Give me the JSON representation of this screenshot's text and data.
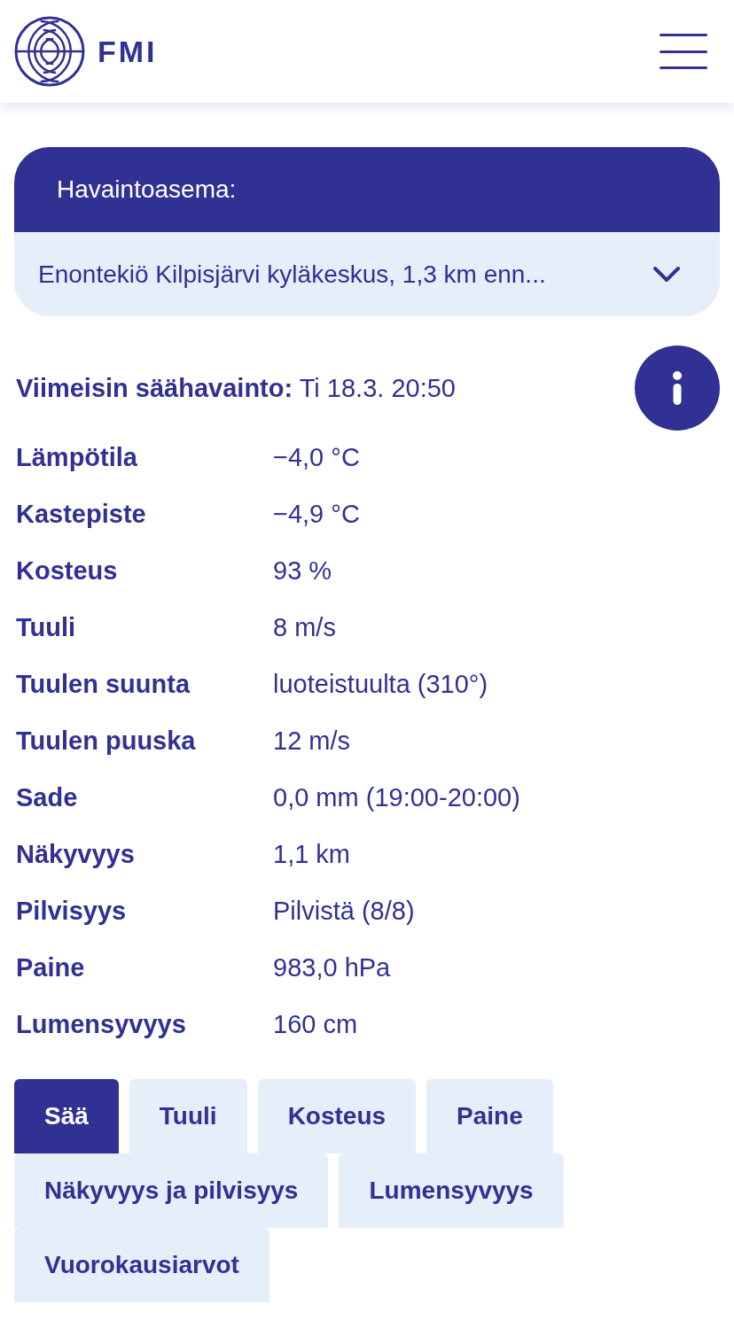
{
  "header": {
    "logo_text": "FMI"
  },
  "station": {
    "label": "Havaintoasema:",
    "value": "Enontekiö Kilpisjärvi kyläkeskus, 1,3 km enn..."
  },
  "observation": {
    "title": "Viimeisin säähavainto:",
    "time": "Ti 18.3. 20:50"
  },
  "rows": [
    {
      "label": "Lämpötila",
      "value": "−4,0 °C"
    },
    {
      "label": "Kastepiste",
      "value": "−4,9 °C"
    },
    {
      "label": "Kosteus",
      "value": "93 %"
    },
    {
      "label": "Tuuli",
      "value": "8 m/s"
    },
    {
      "label": "Tuulen suunta",
      "value": "luoteistuulta (310°)"
    },
    {
      "label": "Tuulen puuska",
      "value": "12 m/s"
    },
    {
      "label": "Sade",
      "value": "0,0 mm (19:00-20:00)"
    },
    {
      "label": "Näkyvyys",
      "value": "1,1 km"
    },
    {
      "label": "Pilvisyys",
      "value": "Pilvistä (8/8)"
    },
    {
      "label": "Paine",
      "value": "983,0 hPa"
    },
    {
      "label": "Lumensyvyys",
      "value": "160 cm"
    }
  ],
  "tabs": [
    {
      "label": "Sää",
      "selected": true
    },
    {
      "label": "Tuuli",
      "selected": false
    },
    {
      "label": "Kosteus",
      "selected": false
    },
    {
      "label": "Paine",
      "selected": false
    },
    {
      "label": "Näkyvyys ja pilvisyys",
      "selected": false
    },
    {
      "label": "Lumensyvyys",
      "selected": false
    },
    {
      "label": "Vuorokausiarvot",
      "selected": false
    }
  ]
}
